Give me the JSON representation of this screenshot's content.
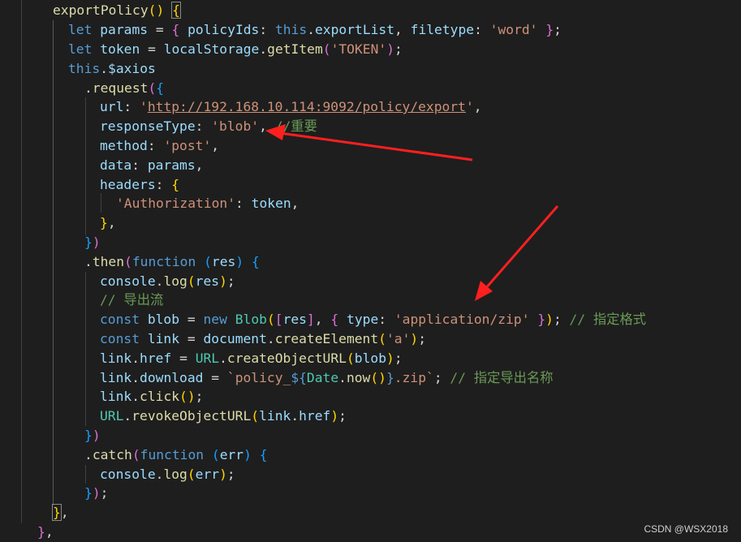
{
  "watermark": "CSDN @WSX2018",
  "code": {
    "l1_name": "exportPolicy",
    "l2_let": "let",
    "l2_params": "params",
    "l2_key": "policyIds",
    "l2_this": "this",
    "l2_export_list": "exportList",
    "l2_filetype_key": "filetype",
    "l2_word": "'word'",
    "l3_let": "let",
    "l3_token": "token",
    "l3_localstorage": "localStorage",
    "l3_getitem": "getItem",
    "l3_token_str": "'TOKEN'",
    "l4_this": "this",
    "l4_axios": "$axios",
    "l5_request": "request",
    "l6_url_key": "url",
    "l6_url_q1": "'",
    "l6_url_val": "http://192.168.10.114:9092/policy/export",
    "l6_url_q2": "'",
    "l7_key": "responseType",
    "l7_val": "'blob'",
    "l7_comment": "//重要",
    "l8_key": "method",
    "l8_val": "'post'",
    "l9_key": "data",
    "l9_val": "params",
    "l10_key": "headers",
    "l11_key": "'Authorization'",
    "l11_val": "token",
    "l14_then": "then",
    "l14_function": "function",
    "l14_res": "res",
    "l15_console": "console",
    "l15_log": "log",
    "l15_res": "res",
    "l16_comment": "// 导出流",
    "l17_const": "const",
    "l17_blob": "blob",
    "l17_new": "new",
    "l17_Blob": "Blob",
    "l17_res": "res",
    "l17_type": "type",
    "l17_zip": "'application/zip'",
    "l17_comment": "// 指定格式",
    "l18_const": "const",
    "l18_link": "link",
    "l18_document": "document",
    "l18_create": "createElement",
    "l18_a": "'a'",
    "l19_link": "link",
    "l19_href": "href",
    "l19_URL": "URL",
    "l19_create": "createObjectURL",
    "l19_blob": "blob",
    "l20_link": "link",
    "l20_download": "download",
    "l20_tpl1": "`policy_",
    "l20_tpl_open": "${",
    "l20_date": "Date",
    "l20_now": "now",
    "l20_tpl_close": "}",
    "l20_tpl2": ".zip`",
    "l20_comment": "// 指定导出名称",
    "l21_link": "link",
    "l21_click": "click",
    "l22_URL": "URL",
    "l22_revoke": "revokeObjectURL",
    "l22_link": "link",
    "l22_href": "href",
    "l24_catch": "catch",
    "l24_function": "function",
    "l24_err": "err",
    "l25_console": "console",
    "l25_log": "log",
    "l25_err": "err"
  }
}
